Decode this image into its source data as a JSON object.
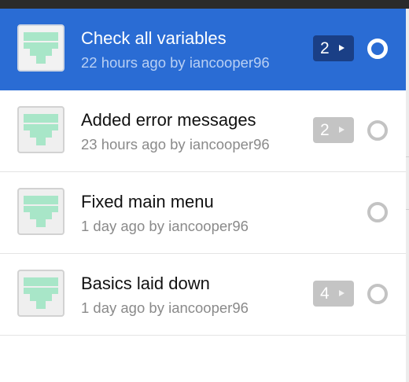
{
  "commits": [
    {
      "title": "Check all variables",
      "meta": "22 hours ago by iancooper96",
      "count": "2",
      "selected": true
    },
    {
      "title": "Added error messages",
      "meta": "23 hours ago by iancooper96",
      "count": "2",
      "selected": false
    },
    {
      "title": "Fixed main menu",
      "meta": "1 day ago by iancooper96",
      "count": "",
      "selected": false
    },
    {
      "title": "Basics laid down",
      "meta": "1 day ago by iancooper96",
      "count": "4",
      "selected": false
    }
  ],
  "colors": {
    "selected_background": "#2a6cd4",
    "badge_selected": "#1a3f86",
    "badge_default": "#c4c4c4",
    "avatar_green": "#a8e6c8"
  },
  "icons": {
    "avatar": "identicon-avatar",
    "badge_arrow": "play-triangle-icon",
    "status": "radio-ring-icon"
  }
}
